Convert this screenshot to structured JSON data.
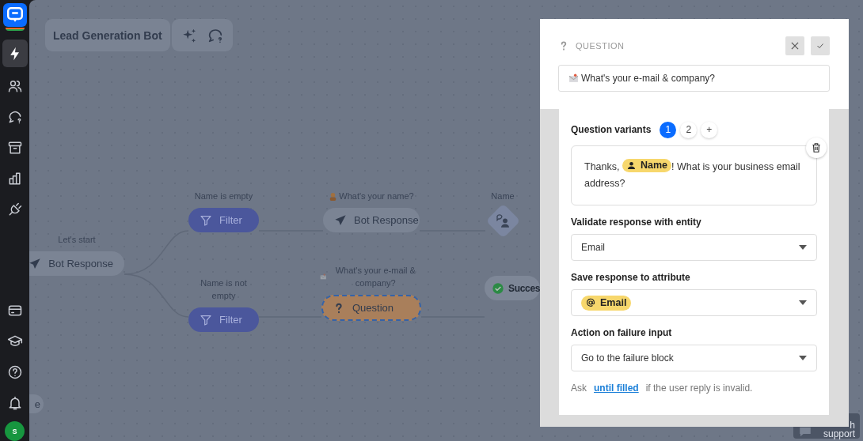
{
  "sidebar": {
    "items": [
      {
        "selected": false
      },
      {
        "selected": true
      },
      {
        "selected": false
      },
      {
        "selected": false
      },
      {
        "selected": false
      },
      {
        "selected": false
      },
      {
        "selected": false
      },
      {
        "selected": false
      },
      {
        "selected": false
      },
      {
        "selected": false
      },
      {
        "selected": false
      }
    ],
    "avatar": {
      "initial": "S"
    }
  },
  "toolbar": {
    "title": "Lead Generation Bot"
  },
  "canvas": {
    "nodes": [
      {
        "kind": "bot_response",
        "caption": "Let's start",
        "label": "Bot Response",
        "selected": false
      },
      {
        "kind": "filter",
        "caption": "Name is empty",
        "label": "Filter",
        "selected": false
      },
      {
        "kind": "bot_response",
        "caption": "What's your name?",
        "label": "Bot Response",
        "selected": false
      },
      {
        "kind": "attribute",
        "caption": "Name",
        "selected": false
      },
      {
        "kind": "filter",
        "caption": "Name is not empty",
        "label": "Filter",
        "selected": false
      },
      {
        "kind": "question",
        "caption": "What's your e-mail & company?",
        "label": "Question",
        "selected": true
      },
      {
        "kind": "success",
        "label": "Succes",
        "selected": false
      },
      {
        "kind": "partial",
        "label": "e",
        "selected": false
      }
    ],
    "support_button": {
      "lines": [
        "h",
        "support"
      ]
    }
  },
  "panel": {
    "type": "QUESTION",
    "title": "What's your e-mail & company?",
    "variants": {
      "label": "Question variants",
      "tabs": [
        {
          "label": "1",
          "selected": true
        },
        {
          "label": "2",
          "selected": false
        }
      ],
      "add": "+",
      "message": {
        "before": "Thanks,",
        "attribute": "Name",
        "after": "! What is your business email address?"
      }
    },
    "fields": [
      {
        "label": "Validate response with entity",
        "kind": "plain",
        "value": "Email"
      },
      {
        "label": "Save response to attribute",
        "kind": "attribute",
        "value": "Email"
      },
      {
        "label": "Action on failure input",
        "kind": "plain",
        "value": "Go to the failure block"
      }
    ],
    "footer": {
      "before": "Ask",
      "link": "until filled",
      "after": "if the user reply is invalid."
    }
  }
}
